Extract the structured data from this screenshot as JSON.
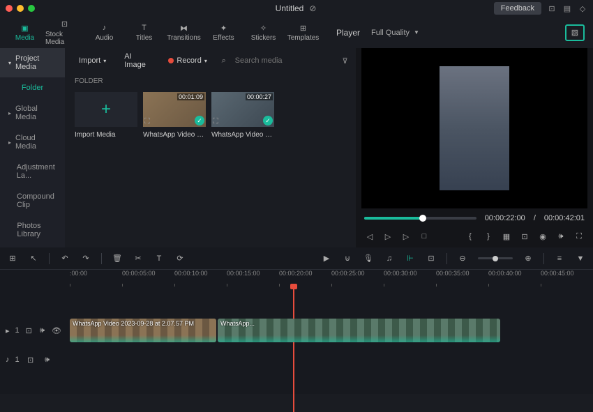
{
  "titlebar": {
    "title": "Untitled",
    "feedback": "Feedback"
  },
  "tabs": [
    {
      "label": "Media",
      "active": true
    },
    {
      "label": "Stock Media"
    },
    {
      "label": "Audio"
    },
    {
      "label": "Titles"
    },
    {
      "label": "Transitions"
    },
    {
      "label": "Effects"
    },
    {
      "label": "Stickers"
    },
    {
      "label": "Templates"
    }
  ],
  "sidebar": {
    "header": "Project Media",
    "active": "Folder",
    "items": [
      "Global Media",
      "Cloud Media",
      "Adjustment La...",
      "Compound Clip",
      "Photos Library"
    ]
  },
  "toolbar": {
    "import": "Import",
    "ai_image": "AI Image",
    "record": "Record",
    "search_placeholder": "Search media"
  },
  "section": "FOLDER",
  "media": {
    "import_label": "Import Media",
    "items": [
      {
        "name": "WhatsApp Video 202...",
        "duration": "00:01:09"
      },
      {
        "name": "WhatsApp Video 202...",
        "duration": "00:00:27"
      }
    ]
  },
  "player": {
    "label": "Player",
    "quality": "Full Quality",
    "current": "00:00:22:00",
    "sep": "/",
    "total": "00:00:42:01"
  },
  "ruler": [
    ":00:00",
    "00:00:05:00",
    "00:00:10:00",
    "00:00:15:00",
    "00:00:20:00",
    "00:00:25:00",
    "00:00:30:00",
    "00:00:35:00",
    "00:00:40:00",
    "00:00:45:00"
  ],
  "clips": {
    "c1": "WhatsApp Video 2023-09-28 at 2.07.57 PM",
    "c2": "WhatsApp..."
  },
  "track_labels": {
    "video": "1",
    "audio": "1"
  }
}
